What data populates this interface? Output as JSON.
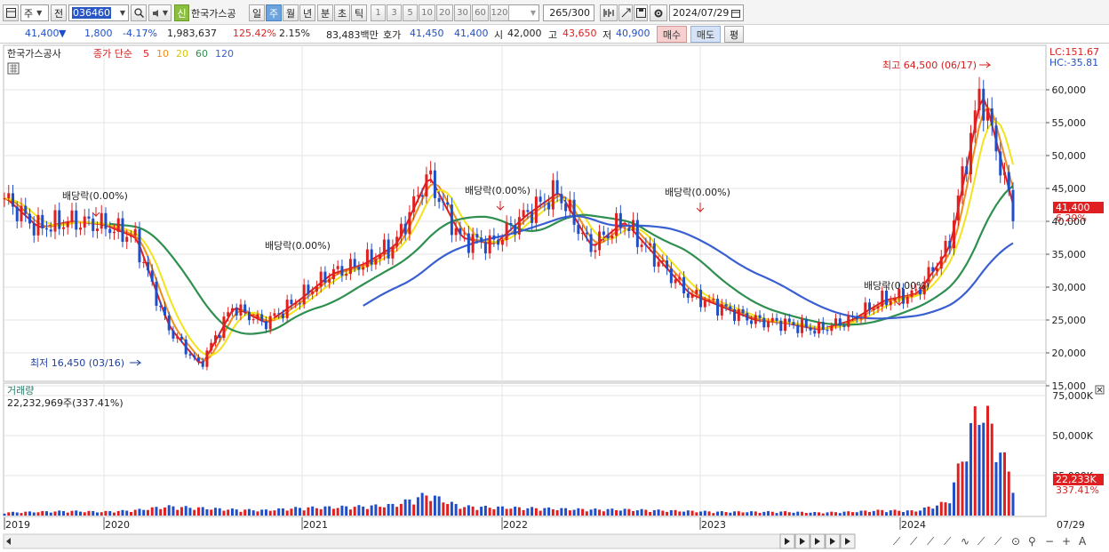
{
  "toolbar": {
    "period_select": "주",
    "prev_label": "전",
    "stock_code": "036460",
    "badge": "신",
    "stock_name": "한국가스공",
    "periods": [
      "일",
      "주",
      "월",
      "년",
      "분",
      "초",
      "틱"
    ],
    "selected_period": "주",
    "minute_options": [
      "1",
      "3",
      "5",
      "10",
      "20",
      "30",
      "60",
      "120"
    ],
    "count": "265",
    "count_total": "/300",
    "date": "2024/07/29"
  },
  "quote": {
    "price": "41,400",
    "arrow": "▼",
    "change": "1,800",
    "change_pct": "-4.17%",
    "volume": "1,983,637",
    "vol_ratio": "125.42%",
    "turnover": "2.15%",
    "amount": "83,483백만",
    "bid_label": "호가",
    "ask": "41,450",
    "bid": "41,400",
    "open_label": "시",
    "open": "42,000",
    "high_label": "고",
    "high": "43,650",
    "low_label": "저",
    "low": "40,900",
    "buy_label": "매수",
    "sell_label": "매도",
    "eval_label": "평"
  },
  "price_panel": {
    "name_tag": "한국가스공사",
    "legend_prefix": "종가 단순",
    "ma": [
      {
        "period": "5",
        "color": "#e02020"
      },
      {
        "period": "10",
        "color": "#f08c1a"
      },
      {
        "period": "20",
        "color": "#f2e31a"
      },
      {
        "period": "60",
        "color": "#2f8f4f"
      },
      {
        "period": "120",
        "color": "#3a5fd0"
      }
    ],
    "lc_label": "LC:151.67",
    "hc_label": "HC:-35.81",
    "high_mark": "최고 64,500 (06/17)",
    "low_mark": "최저 16,450 (03/16)",
    "current_price_tag": "41,400",
    "current_pct_tag": "6.29%",
    "y_ticks": [
      "60,000",
      "55,000",
      "50,000",
      "45,000",
      "40,000",
      "35,000",
      "30,000",
      "25,000",
      "20,000",
      "15,000"
    ],
    "dividend_label": "배당락(0.00%)"
  },
  "volume_panel": {
    "title": "거래량",
    "value": "22,232,969주(337.41%)",
    "y_ticks": [
      "75,000K",
      "50,000K",
      "25,000K"
    ],
    "cur_tag": "22,233K",
    "cur_pct": "337.41%"
  },
  "x_labels": [
    "2019",
    "2020",
    "2021",
    "2022",
    "2023",
    "2024",
    "07/29"
  ],
  "colors": {
    "up": "#e02020",
    "down": "#1f4fc8",
    "grid": "#e4e4e4",
    "accent": "#4b83c0"
  },
  "chart_data": {
    "type": "candlestick",
    "title": "한국가스공사",
    "series": [
      {
        "name": "종가",
        "x": [
          "2019",
          "2019-05",
          "2019-08",
          "2019-11",
          "2020-01",
          "2020-03",
          "2020-05",
          "2020-08",
          "2020-10",
          "2021-01",
          "2021-04",
          "2021-07",
          "2021-09",
          "2021-10",
          "2021-12",
          "2022-02",
          "2022-04",
          "2022-06",
          "2022-08",
          "2022-10",
          "2022-12",
          "2023-02",
          "2023-04",
          "2023-06",
          "2023-08",
          "2023-10",
          "2023-12",
          "2024-02",
          "2024-04",
          "2024-05",
          "2024-06",
          "2024-07"
        ],
        "values": [
          43500,
          39000,
          40000,
          39500,
          37500,
          24000,
          18000,
          27000,
          24500,
          28000,
          32000,
          33500,
          36500,
          47000,
          37500,
          36500,
          41000,
          44500,
          36000,
          40000,
          34500,
          29000,
          27000,
          25000,
          24500,
          23500,
          25000,
          28000,
          29000,
          36000,
          60000,
          41400
        ]
      }
    ],
    "price_range": [
      15000,
      65000
    ],
    "max": {
      "value": 64500,
      "date": "06/17"
    },
    "min": {
      "value": 16450,
      "date": "03/16"
    },
    "volume_k": [
      2000,
      2500,
      3000,
      2500,
      3500,
      6000,
      5000,
      4000,
      3500,
      5000,
      5500,
      6000,
      7000,
      14000,
      6000,
      5500,
      5000,
      4500,
      4000,
      4000,
      3500,
      3000,
      2500,
      2500,
      2500,
      2000,
      2500,
      3500,
      3000,
      9000,
      75000,
      22233
    ]
  }
}
